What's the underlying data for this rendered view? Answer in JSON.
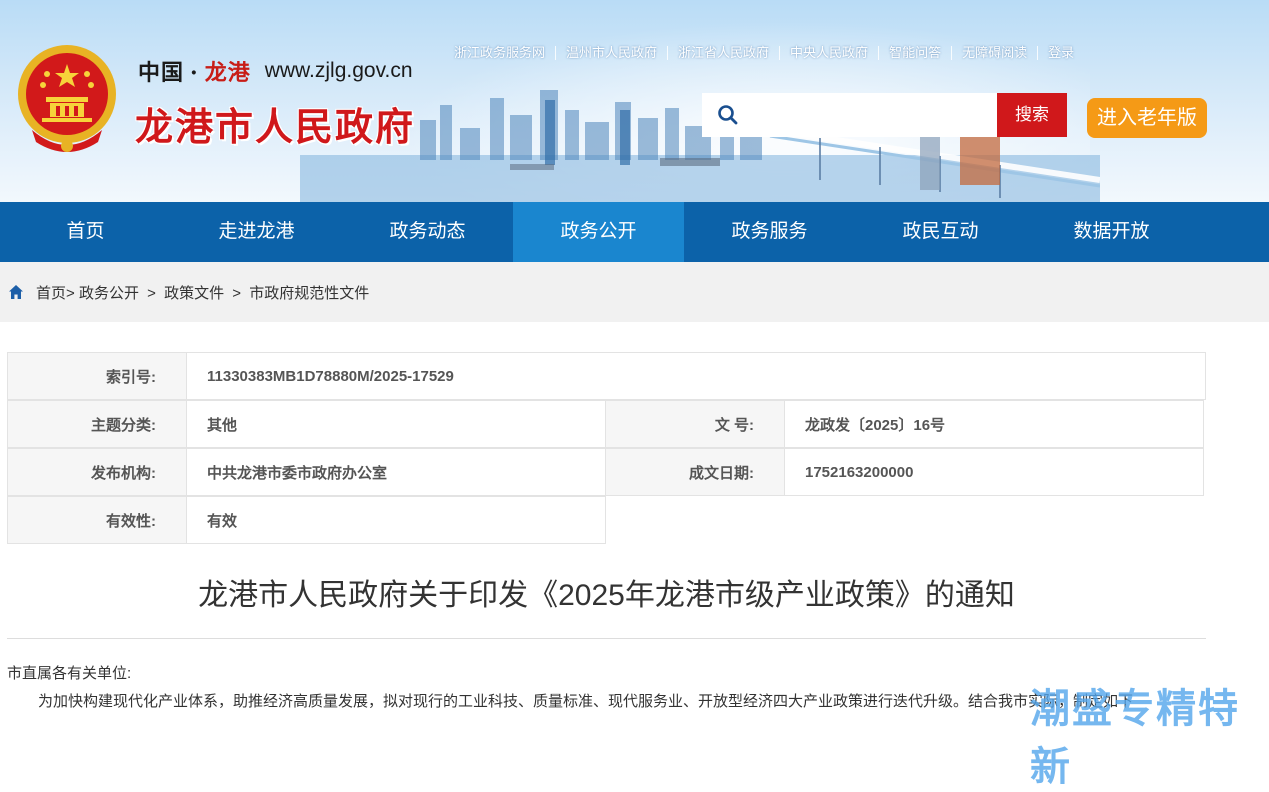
{
  "header": {
    "brand_cn_left": "中国",
    "brand_cn_dot": "·",
    "brand_cn_right": "龙港",
    "brand_url": "www.zjlg.gov.cn",
    "brand_title": "龙港市人民政府",
    "top_links": [
      "浙江政务服务网",
      "温州市人民政府",
      "浙江省人民政府",
      "中央人民政府",
      "智能问答",
      "无障碍阅读",
      "登录"
    ],
    "search": {
      "placeholder": "",
      "button_label": "搜索"
    },
    "elder_button": "进入老年版"
  },
  "nav": {
    "items": [
      "首页",
      "走进龙港",
      "政务动态",
      "政务公开",
      "政务服务",
      "政民互动",
      "数据开放"
    ],
    "active_index": 3
  },
  "breadcrumb": {
    "items": [
      "首页",
      "政务公开",
      "政策文件",
      "市政府规范性文件"
    ],
    "sep_first": ">",
    "sep": ">"
  },
  "meta": {
    "index_label": "索引号:",
    "index_value": "11330383MB1D78880M/2025-17529",
    "category_label": "主题分类:",
    "category_value": "其他",
    "doc_no_label": "文  号:",
    "doc_no_value": "龙政发〔2025〕16号",
    "issuer_label": "发布机构:",
    "issuer_value": "中共龙港市委市政府办公室",
    "date_label": "成文日期:",
    "date_value": "1752163200000",
    "validity_label": "有效性:",
    "validity_value": "有效"
  },
  "article": {
    "title": "龙港市人民政府关于印发《2025年龙港市级产业政策》的通知",
    "salutation": "市直属各有关单位:",
    "paragraph": "为加快构建现代化产业体系，助推经济高质量发展，拟对现行的工业科技、质量标准、现代服务业、开放型经济四大产业政策进行迭代升级。结合我市实际，制定如下"
  },
  "watermark": "潮盛专精特新",
  "colors": {
    "nav_bg": "#0c62a9",
    "nav_active": "#1a86cf",
    "brand_red": "#d0181b",
    "search_btn": "#d0181b",
    "elder_btn": "#f59a16"
  }
}
